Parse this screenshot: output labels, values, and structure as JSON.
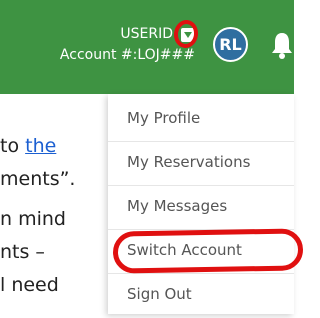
{
  "header": {
    "userid": "USERID",
    "account_line": "Account #:LOJ###",
    "avatar_initials": "RL"
  },
  "body": {
    "line1_prefix": "to ",
    "line1_link": "the",
    "line2": "ments”.",
    "line3": "n mind",
    "line4": "nts –",
    "line5": "l need"
  },
  "menu": {
    "items": [
      {
        "label": "My Profile"
      },
      {
        "label": "My Reservations"
      },
      {
        "label": "My Messages"
      },
      {
        "label": "Switch Account"
      },
      {
        "label": "Sign Out"
      }
    ]
  },
  "colors": {
    "header_bg": "#3e9342",
    "avatar_bg": "#2f6ea0",
    "annotation": "#e01010",
    "link": "#1b5fd1"
  }
}
